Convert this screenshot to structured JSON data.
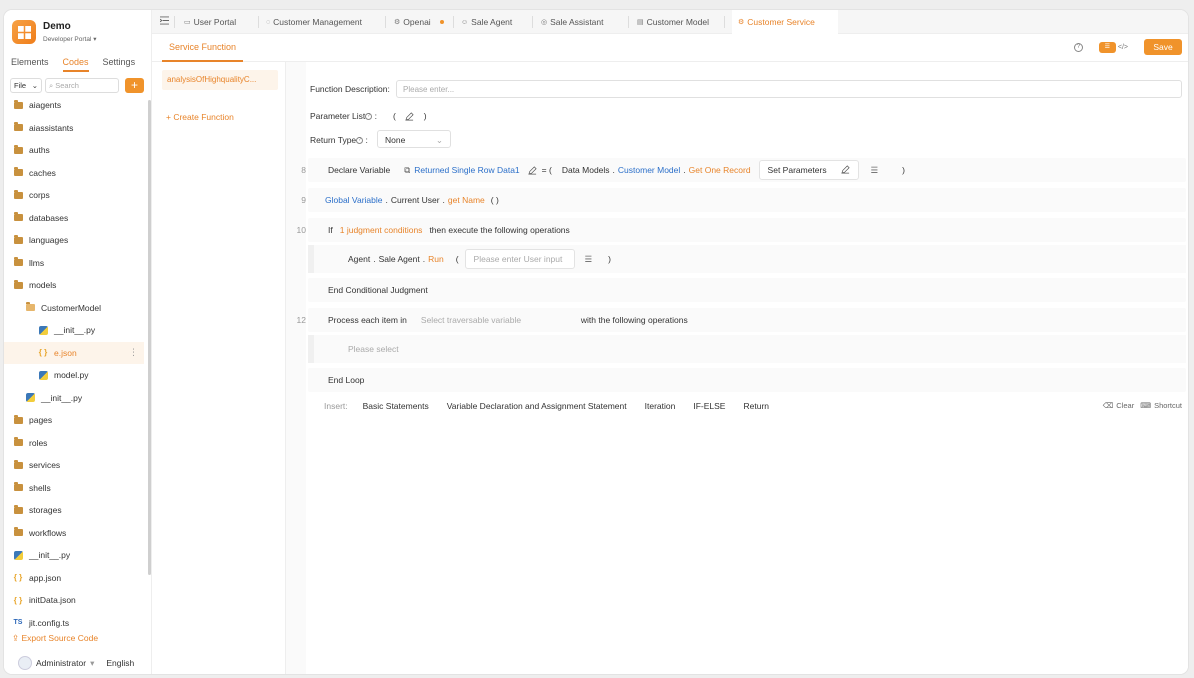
{
  "brand": {
    "name": "Demo",
    "subtitle": "Developer Portal"
  },
  "sidebar_tabs": [
    "Elements",
    "Codes",
    "Settings"
  ],
  "filter": {
    "type": "File",
    "search_placeholder": "Search"
  },
  "tree": [
    {
      "label": "aiagents",
      "kind": "folder"
    },
    {
      "label": "aiassistants",
      "kind": "folder"
    },
    {
      "label": "auths",
      "kind": "folder"
    },
    {
      "label": "caches",
      "kind": "folder"
    },
    {
      "label": "corps",
      "kind": "folder"
    },
    {
      "label": "databases",
      "kind": "folder"
    },
    {
      "label": "languages",
      "kind": "folder"
    },
    {
      "label": "llms",
      "kind": "folder"
    },
    {
      "label": "models",
      "kind": "folder"
    },
    {
      "label": "CustomerModel",
      "kind": "folder-open"
    },
    {
      "label": "__init__.py",
      "kind": "py"
    },
    {
      "label": "e.json",
      "kind": "json"
    },
    {
      "label": "model.py",
      "kind": "py"
    },
    {
      "label": "__init__.py",
      "kind": "py"
    },
    {
      "label": "pages",
      "kind": "folder"
    },
    {
      "label": "roles",
      "kind": "folder"
    },
    {
      "label": "services",
      "kind": "folder"
    },
    {
      "label": "shells",
      "kind": "folder"
    },
    {
      "label": "storages",
      "kind": "folder"
    },
    {
      "label": "workflows",
      "kind": "folder"
    },
    {
      "label": "__init__.py",
      "kind": "py"
    },
    {
      "label": "app.json",
      "kind": "json"
    },
    {
      "label": "initData.json",
      "kind": "json"
    },
    {
      "label": "jit.config.ts",
      "kind": "ts"
    }
  ],
  "export_label": "Export Source Code",
  "user": {
    "name": "Administrator",
    "language": "English"
  },
  "tabs": [
    "User Portal",
    "Customer Management",
    "Openai",
    "Sale Agent",
    "Sale Assistant",
    "Customer Model",
    "Customer Service"
  ],
  "subtab": "Service Function",
  "toolbar": {
    "save_label": "Save"
  },
  "function_item": "analysisOfHighqualityC...",
  "create_function": "+ Create Function",
  "form": {
    "description_label": "Function Description:",
    "description_placeholder": "Please enter...",
    "param_label": "Parameter List",
    "return_label": "Return Type",
    "return_value": "None"
  },
  "stmt8": {
    "num": "8",
    "keyword": "Declare Variable",
    "var": "Returned Single Row Data1",
    "eq": "= (",
    "models": "Data Models",
    "model": "Customer Model",
    "method": "Get One Record",
    "set_params": "Set Parameters",
    "close": ")"
  },
  "stmt9": {
    "num": "9",
    "a": "Global Variable",
    "b": "Current User",
    "method": "get Name",
    "parens": "( )"
  },
  "stmt10": {
    "num": "10",
    "if": "If",
    "cond": "1 judgment conditions",
    "then": "then execute the following operations"
  },
  "stmt_agent": {
    "a": "Agent",
    "b": "Sale Agent",
    "method": "Run",
    "open": "(",
    "placeholder": "Please enter User input",
    "close": ")"
  },
  "end_cond": "End Conditional Judgment",
  "stmt12": {
    "num": "12",
    "label": "Process each item in",
    "placeholder": "Select traversable variable",
    "tail": "with the following operations"
  },
  "loop_placeholder": "Please select",
  "end_loop": "End Loop",
  "insert": {
    "label": "Insert:",
    "options": [
      "Basic Statements",
      "Variable Declaration and Assignment Statement",
      "Iteration",
      "IF-ELSE",
      "Return"
    ]
  },
  "actions": {
    "clear": "Clear",
    "shortcut": "Shortcut"
  }
}
